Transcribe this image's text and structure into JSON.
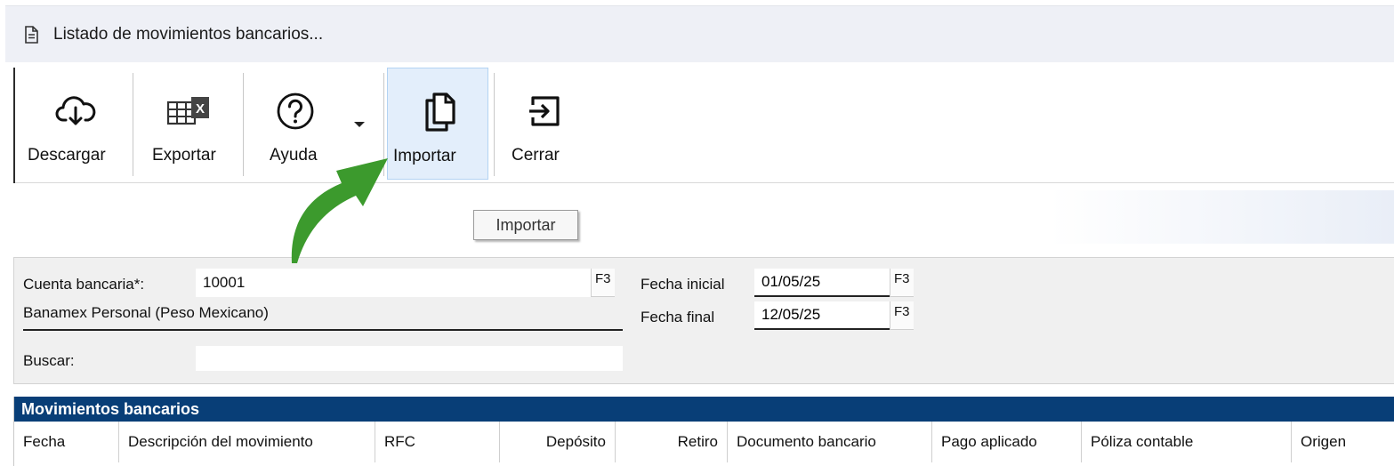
{
  "window": {
    "title": "Listado de movimientos bancarios...",
    "icon": "document-icon"
  },
  "toolbar": {
    "buttons": [
      {
        "label": "Descargar",
        "icon": "cloud-download-icon"
      },
      {
        "label": "Exportar",
        "icon": "excel-grid-icon"
      },
      {
        "label": "Ayuda",
        "icon": "help-circle-icon"
      },
      {
        "label": "Importar",
        "icon": "copy-pages-icon"
      },
      {
        "label": "Cerrar",
        "icon": "exit-arrow-icon"
      }
    ],
    "tooltip": "Importar"
  },
  "filters": {
    "cuenta_label": "Cuenta bancaria*:",
    "cuenta_value": "10001",
    "cuenta_f3": "F3",
    "cuenta_desc": "Banamex Personal (Peso Mexicano)",
    "buscar_label": "Buscar:",
    "buscar_value": "",
    "fecha_inicial_label": "Fecha inicial",
    "fecha_inicial_value": "01/05/25",
    "fecha_inicial_f3": "F3",
    "fecha_final_label": "Fecha final",
    "fecha_final_value": "12/05/25",
    "fecha_final_f3": "F3"
  },
  "grid": {
    "title": "Movimientos bancarios",
    "columns": [
      "Fecha",
      "Descripción del movimiento",
      "RFC",
      "Depósito",
      "Retiro",
      "Documento bancario",
      "Pago aplicado",
      "Póliza contable",
      "Origen"
    ]
  },
  "colors": {
    "grid_header": "#083e77",
    "arrow": "#3c9a2d",
    "active_button": "#e3eefb"
  }
}
